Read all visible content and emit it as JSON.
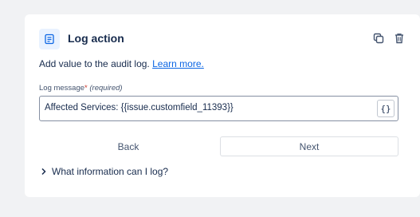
{
  "header": {
    "title": "Log action"
  },
  "description": {
    "text": "Add value to the audit log.",
    "link": "Learn more."
  },
  "field": {
    "label": "Log message",
    "required_star": "*",
    "required_text": "(required)",
    "value": "Affected Services: {{issue.customfield_11393}}",
    "smart_value_button": "{}"
  },
  "buttons": {
    "back": "Back",
    "next": "Next"
  },
  "expander": {
    "label": "What information can I log?"
  },
  "icons": {
    "action": "audit-log-icon",
    "copy": "copy-icon",
    "delete": "trash-icon",
    "expand": "chevron-right-icon"
  },
  "colors": {
    "accent": "#0c66e4",
    "icon_bg": "#e9f2ff",
    "required": "#c9372c",
    "background": "#f1f2f4"
  }
}
